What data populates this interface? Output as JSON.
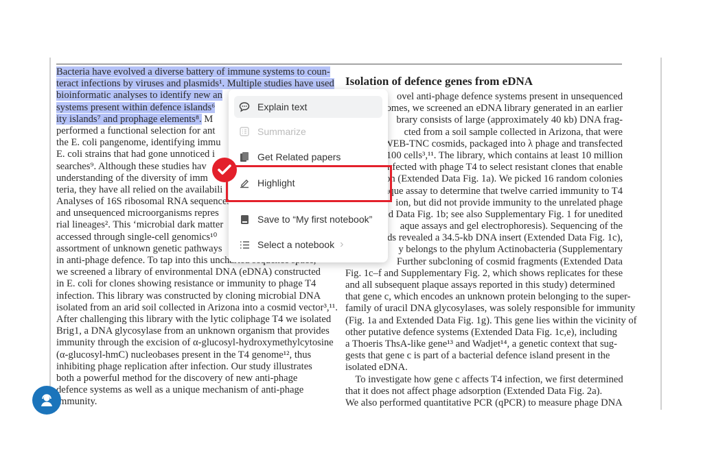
{
  "colors": {
    "selection": "#b5c2f7",
    "highlight_box": "#e3202b",
    "avatar": "#1b74bb"
  },
  "left_column": {
    "selected_lines": [
      "Bacteria have evolved a diverse battery of immune systems to coun-",
      "teract infections by viruses and plasmids¹. Multiple studies have used",
      "bioinformatic analyses to identify new an",
      "systems present within defence islands⁶",
      "ity islands⁷ and prophage elements⁸."
    ],
    "line5_tail": " M",
    "lines": [
      "performed a functional selection for ant",
      "the E. coli pangenome, identifying immu",
      "E. coli strains that had gone unnoticed i",
      "searches⁹. Although these studies hav",
      "understanding of the diversity of imm",
      "teria, they have all relied on the availabili",
      "Analyses of 16S ribosomal RNA sequences",
      "and unsequenced microorganisms repres",
      "rial lineages². This ‘microbial dark matter",
      "accessed through single-cell genomics¹⁰",
      "assortment of unknown genetic pathways",
      "in anti-phage defence. To tap into this uncharted sequence space,",
      "we screened a library of environmental DNA (eDNA) constructed",
      "in E. coli for clones showing resistance or immunity to phage T4",
      "infection. This library was constructed by cloning microbial DNA",
      "isolated from an arid soil collected in Arizona into a cosmid vector³,¹¹.",
      "After challenging this library with the lytic coliphage T4 we isolated",
      "Brig1, a DNA glycosylase from an unknown organism that provides",
      "immunity through the excision of α-glucosyl-hydroxymethylcytosine",
      "(α-glucosyl-hmC) nucleobases present in the T4 genome¹², thus",
      "inhibiting phage replication after infection. Our study illustrates",
      "both a powerful method for the discovery of new anti-phage",
      "defence systems as well as a unique mechanism of anti-phage",
      "immunity."
    ]
  },
  "right_column": {
    "heading": "Isolation of defence genes from eDNA",
    "lines": [
      "ovel anti-phage defence systems present in unsequenced",
      "omes, we screened an eDNA library generated in an earlier",
      "brary consists of large (approximately 40 kb) DNA frag-",
      "cted from a soil sample collected in Arizona, that were",
      "WEB-TNC cosmids, packaged into λ phage and transfected",
      "C100 cells³,¹¹. The library, which contains at least 10 million",
      "nfected with phage T4 to select resistant clones that enable",
      "ation (Extended Data Fig. 1a). We picked 16 random colonies",
      "aque assay to determine that twelve carried immunity to T4",
      "ion, but did not provide immunity to the unrelated phage",
      "ed Data Fig. 1b; see also Supplementary Fig. 1 for unedited",
      "aque assays and gel electrophoresis). Sequencing of the",
      "mids revealed a 34.5-kb DNA insert (Extended Data Fig. 1c),",
      "y belongs to the phylum Actinobacteria (Supplementary",
      "Further subcloning of cosmid fragments (Extended Data",
      "Fig. 1c–f and Supplementary Fig. 2, which shows replicates for these",
      "and all subsequent plaque assays reported in this study) determined",
      "that gene c, which encodes an unknown protein belonging to the super-",
      "family of uracil DNA glycosylases, was solely responsible for immunity",
      "(Fig. 1a and Extended Data Fig. 1g). This gene lies within the vicinity of",
      "other putative defence systems (Extended Data Fig. 1c,e), including",
      "a Thoeris ThsA-like gene¹³ and Wadjet¹⁴, a genetic context that sug-",
      "gests that gene c is part of a bacterial defence island present in the",
      "isolated eDNA.",
      "    To investigate how gene c affects T4 infection, we first determined",
      "that it does not affect phage adsorption (Extended Data Fig. 2a).",
      "We also performed quantitative PCR (qPCR) to measure phage DNA"
    ]
  },
  "menu": {
    "items": [
      {
        "label": "Explain text",
        "icon": "speech-bubble-icon",
        "state": "hover"
      },
      {
        "label": "Summarize",
        "icon": "list-doc-icon",
        "state": "disabled"
      },
      {
        "label": "Get Related papers",
        "icon": "papers-icon",
        "state": "normal"
      },
      {
        "label": "Highlight",
        "icon": "highlighter-icon",
        "state": "marked"
      },
      {
        "label": "Save to “My first notebook”",
        "icon": "notebook-icon",
        "state": "normal"
      },
      {
        "label": "Select a notebook",
        "icon": "list-icon",
        "state": "normal",
        "submenu": true
      }
    ]
  }
}
